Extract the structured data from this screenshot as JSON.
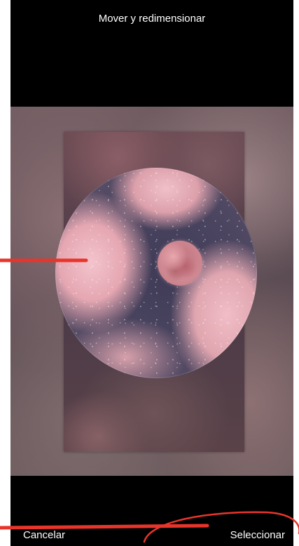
{
  "header": {
    "title": "Mover y redimensionar"
  },
  "footer": {
    "cancel_label": "Cancelar",
    "select_label": "Seleccionar"
  },
  "annotation_color": "#e8352b"
}
